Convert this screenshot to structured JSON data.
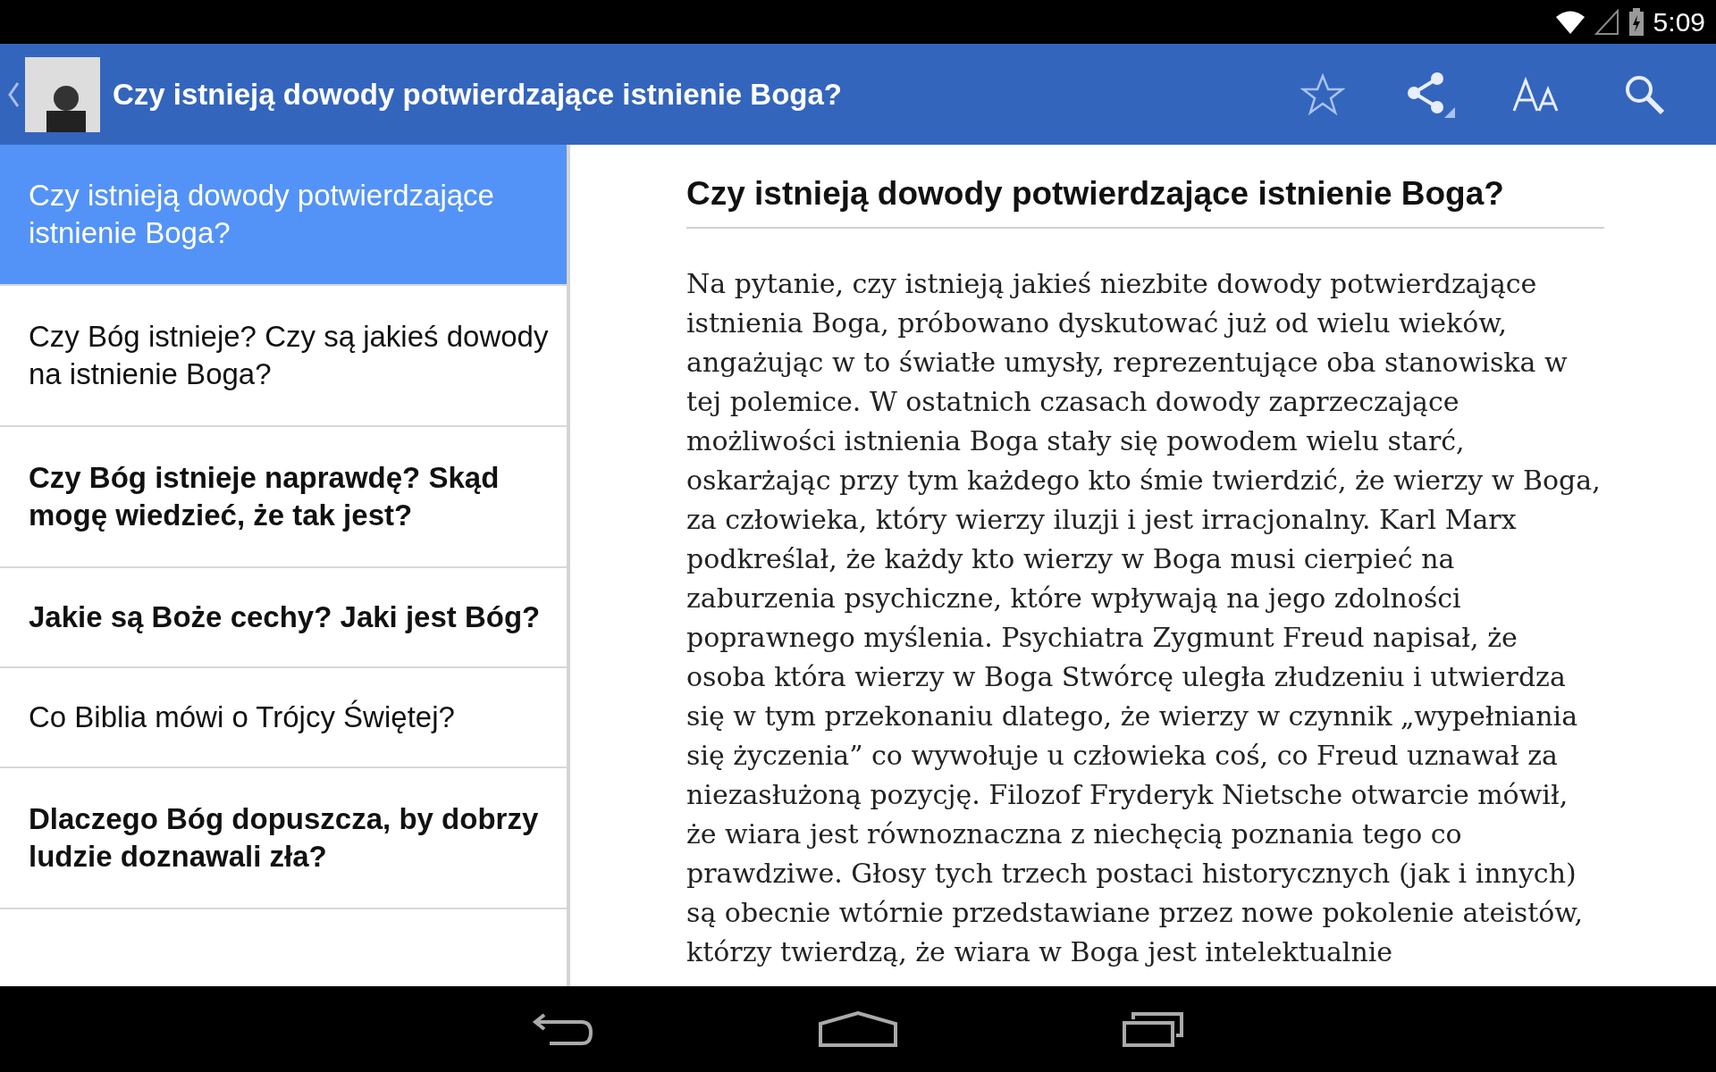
{
  "status_bar": {
    "time": "5:09"
  },
  "app_bar": {
    "title": "Czy istnieją dowody potwierdzające istnienie Boga?"
  },
  "list": [
    {
      "title": "Czy istnieją dowody potwierdzające istnienie Boga?",
      "selected": true,
      "unread": false
    },
    {
      "title": "Czy Bóg istnieje? Czy są jakieś dowody na istnienie Boga?",
      "selected": false,
      "unread": false
    },
    {
      "title": "Czy Bóg istnieje naprawdę? Skąd mogę wiedzieć, że tak jest?",
      "selected": false,
      "unread": true
    },
    {
      "title": "Jakie są Boże cechy? Jaki jest Bóg?",
      "selected": false,
      "unread": true
    },
    {
      "title": "Co Biblia mówi o Trójcy Świętej?",
      "selected": false,
      "unread": false
    },
    {
      "title": "Dlaczego Bóg dopuszcza, by dobrzy ludzie doznawali zła?",
      "selected": false,
      "unread": true
    }
  ],
  "article": {
    "heading": "Czy istnieją dowody potwierdzające istnienie Boga?",
    "body": "Na pytanie, czy istnieją jakieś niezbite dowody potwierdzające istnienia Boga, próbowano dyskutować już od wielu wieków, angażując w to światłe umysły, reprezentujące oba stanowiska w tej polemice. W ostatnich czasach dowody zaprzeczające możliwości istnienia Boga stały się powodem wielu starć, oskarżając przy tym każdego kto śmie twierdzić, że wierzy w Boga, za człowieka, który wierzy iluzji i jest irracjonalny. Karl Marx podkreślał, że każdy kto wierzy w Boga musi cierpieć na zaburzenia psychiczne, które wpływają na jego zdolności poprawnego myślenia. Psychiatra Zygmunt Freud napisał, że osoba która wierzy w Boga Stwórcę uległa złudzeniu i utwierdza się w tym przekonaniu dlatego, że wierzy w czynnik „wypełniania się życzenia” co wywołuje u człowieka coś, co Freud uznawał za niezasłużoną pozycję. Filozof Fryderyk Nietsche otwarcie mówił, że wiara jest równoznaczna z niechęcią poznania tego co prawdziwe. Głosy tych trzech postaci historycznych (jak i innych) są obecnie wtórnie przedstawiane przez nowe pokolenie ateistów, którzy twierdzą, że wiara w Boga jest intelektualnie"
  }
}
